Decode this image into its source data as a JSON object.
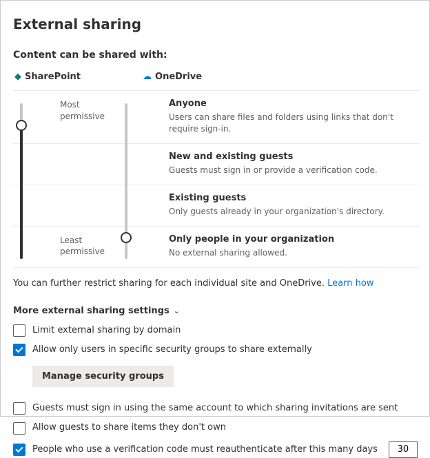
{
  "title": "External sharing",
  "subtitle": "Content can be shared with:",
  "products": {
    "sharepoint": "SharePoint",
    "onedrive": "OneDrive"
  },
  "scale": {
    "most": "Most permissive",
    "least": "Least permissive"
  },
  "options": [
    {
      "title": "Anyone",
      "desc": "Users can share files and folders using links that don't require sign-in."
    },
    {
      "title": "New and existing guests",
      "desc": "Guests must sign in or provide a verification code."
    },
    {
      "title": "Existing guests",
      "desc": "Only guests already in your organization's directory."
    },
    {
      "title": "Only people in your organization",
      "desc": "No external sharing allowed."
    }
  ],
  "restrict_note": "You can further restrict sharing for each individual site and OneDrive.",
  "learn_link": "Learn how",
  "more_header": "More external sharing settings",
  "checks": {
    "limit_domain": "Limit external sharing by domain",
    "security_groups": "Allow only users in specific security groups to share externally",
    "same_account": "Guests must sign in using the same account to which sharing invitations are sent",
    "share_not_own": "Allow guests to share items they don't own",
    "reauth_days": "People who use a verification code must reauthenticate after this many days"
  },
  "buttons": {
    "manage_groups": "Manage security groups"
  },
  "values": {
    "reauth_days": "30"
  }
}
